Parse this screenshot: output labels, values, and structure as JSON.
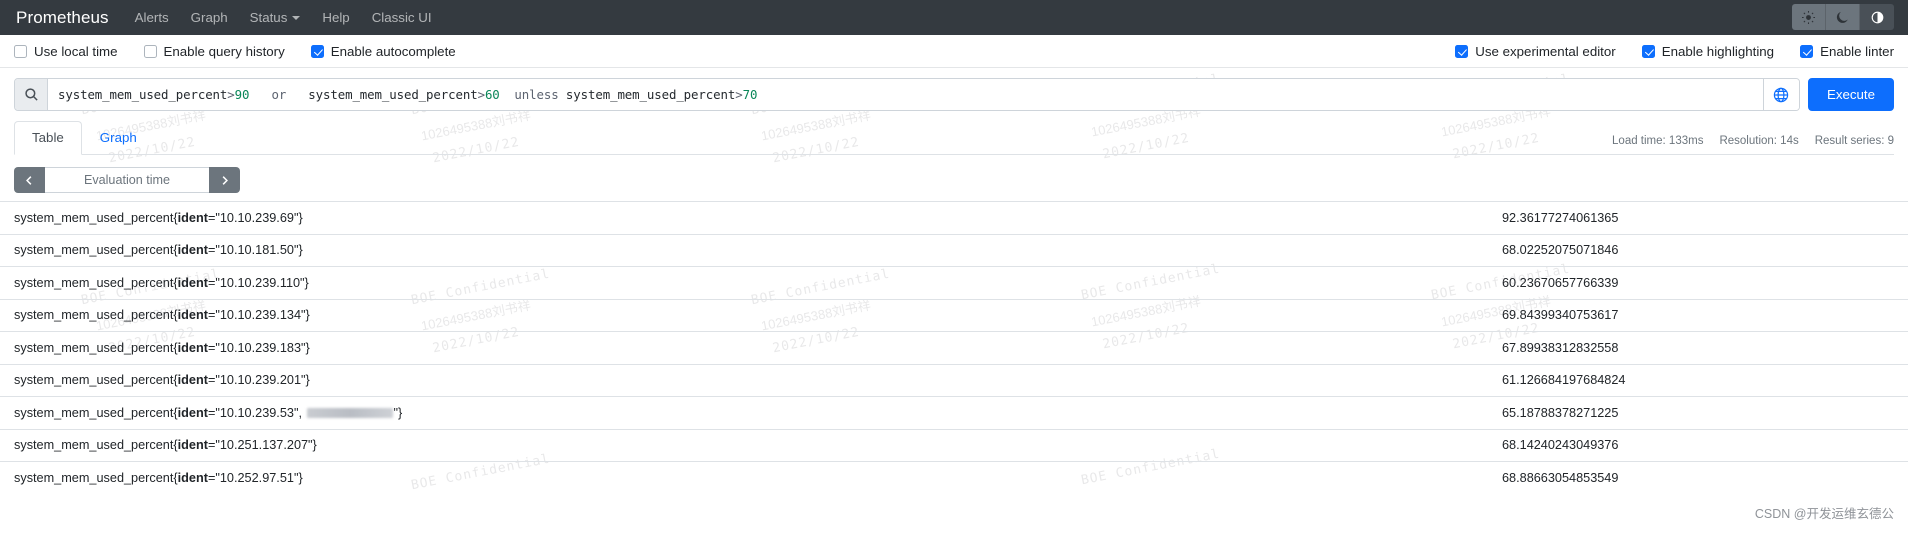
{
  "navbar": {
    "brand": "Prometheus",
    "links": [
      {
        "label": "Alerts",
        "caret": false
      },
      {
        "label": "Graph",
        "caret": false
      },
      {
        "label": "Status",
        "caret": true
      },
      {
        "label": "Help",
        "caret": false
      },
      {
        "label": "Classic UI",
        "caret": false
      }
    ],
    "theme_buttons": [
      {
        "name": "sun-icon",
        "glyph": "⚙"
      },
      {
        "name": "moon-icon",
        "glyph": "☾"
      },
      {
        "name": "contrast-icon",
        "glyph": "◐"
      }
    ]
  },
  "options": {
    "left": [
      {
        "label": "Use local time",
        "checked": false
      },
      {
        "label": "Enable query history",
        "checked": false
      },
      {
        "label": "Enable autocomplete",
        "checked": true
      }
    ],
    "right": [
      {
        "label": "Use experimental editor",
        "checked": true
      },
      {
        "label": "Enable highlighting",
        "checked": true
      },
      {
        "label": "Enable linter",
        "checked": true
      }
    ]
  },
  "query": {
    "search_icon": "search-icon",
    "globe_icon": "globe-icon",
    "execute_label": "Execute",
    "tokens": [
      {
        "text": "system_mem_used_percent",
        "type": "kw"
      },
      {
        "text": " > ",
        "type": "op"
      },
      {
        "text": "90",
        "type": "num"
      },
      {
        "text": "   or   ",
        "type": "op"
      },
      {
        "text": "system_mem_used_percent",
        "type": "kw"
      },
      {
        "text": " > ",
        "type": "op"
      },
      {
        "text": "60",
        "type": "num"
      },
      {
        "text": "  unless ",
        "type": "op"
      },
      {
        "text": "system_mem_used_percent",
        "type": "kw"
      },
      {
        "text": " > ",
        "type": "op"
      },
      {
        "text": "70",
        "type": "num"
      }
    ],
    "full_text": "system_mem_used_percent > 90   or   system_mem_used_percent > 60  unless system_mem_used_percent > 70"
  },
  "tabs": [
    {
      "label": "Table",
      "active": true
    },
    {
      "label": "Graph",
      "active": false
    }
  ],
  "stats": {
    "load_time": "Load time: 133ms",
    "resolution": "Resolution: 14s",
    "result_series": "Result series: 9"
  },
  "evaluation": {
    "prev_icon": "chevron-left-icon",
    "next_icon": "chevron-right-icon",
    "placeholder": "Evaluation time"
  },
  "table": {
    "metric": "system_mem_used_percent",
    "label_key": "ident",
    "rows": [
      {
        "prefix": "system_mem_used_percent{",
        "key": "ident",
        "eq": "=",
        "value": "\"10.10.239.69\"}",
        "redacted": false,
        "number": "92.36177274061365"
      },
      {
        "prefix": "system_mem_used_percent{",
        "key": "ident",
        "eq": "=",
        "value": "\"10.10.181.50\"}",
        "redacted": false,
        "number": "68.02252075071846"
      },
      {
        "prefix": "system_mem_used_percent{",
        "key": "ident",
        "eq": "=",
        "value": "\"10.10.239.110\"}",
        "redacted": false,
        "number": "60.23670657766339"
      },
      {
        "prefix": "system_mem_used_percent{",
        "key": "ident",
        "eq": "=",
        "value": "\"10.10.239.134\"}",
        "redacted": false,
        "number": "69.84399340753617"
      },
      {
        "prefix": "system_mem_used_percent{",
        "key": "ident",
        "eq": "=",
        "value": "\"10.10.239.183\"}",
        "redacted": false,
        "number": "67.89938312832558"
      },
      {
        "prefix": "system_mem_used_percent{",
        "key": "ident",
        "eq": "=",
        "value": "\"10.10.239.201\"}",
        "redacted": false,
        "number": "61.126684197684824"
      },
      {
        "prefix": "system_mem_used_percent{",
        "key": "ident",
        "eq": "=",
        "value": "\"10.10.239.53\", ",
        "suffix": "\"}",
        "redacted": true,
        "number": "65.18788378271225"
      },
      {
        "prefix": "system_mem_used_percent{",
        "key": "ident",
        "eq": "=",
        "value": "\"10.251.137.207\"}",
        "redacted": false,
        "number": "68.14240243049376"
      },
      {
        "prefix": "system_mem_used_percent{",
        "key": "ident",
        "eq": "=",
        "value": "\"10.252.97.51\"}",
        "redacted": false,
        "number": "68.88663054853549"
      }
    ]
  },
  "watermarks": {
    "confidential": "BOE Confidential",
    "id": "1026495388刘书祥",
    "date": "2022/10/22"
  },
  "attribution": {
    "text": "CSDN @开发运维玄德公"
  },
  "colors": {
    "navbar_bg": "#343a40",
    "accent": "#0d6efd",
    "number_token": "#098658",
    "muted": "#6c757d"
  }
}
